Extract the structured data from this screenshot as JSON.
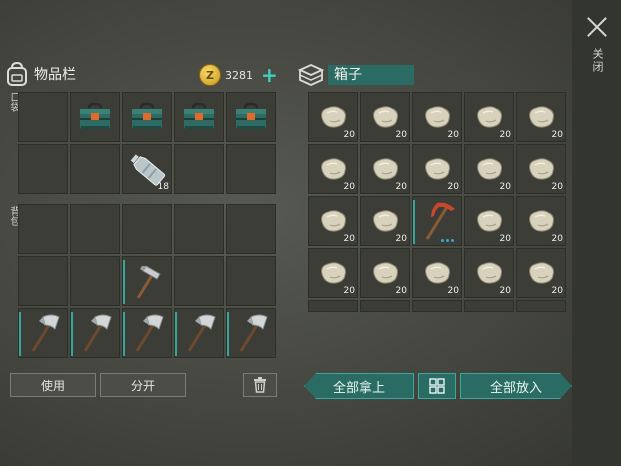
{
  "inventory": {
    "title": "物品栏",
    "coins": "3281",
    "coin_symbol": "Z",
    "plus": "+",
    "pocket_label": "口袋",
    "backpack_label": "背包",
    "pocket_slots": [
      {
        "item": "empty"
      },
      {
        "item": "toolbox"
      },
      {
        "item": "toolbox"
      },
      {
        "item": "toolbox"
      },
      {
        "item": "toolbox"
      },
      {
        "item": "empty"
      },
      {
        "item": "empty"
      },
      {
        "item": "water-bottle",
        "count": "18"
      },
      {
        "item": "empty"
      },
      {
        "item": "empty"
      }
    ],
    "backpack_slots": [
      {
        "item": "empty"
      },
      {
        "item": "empty"
      },
      {
        "item": "empty"
      },
      {
        "item": "empty"
      },
      {
        "item": "empty"
      },
      {
        "item": "empty"
      },
      {
        "item": "empty"
      },
      {
        "item": "hammer",
        "highlight": true
      },
      {
        "item": "empty"
      },
      {
        "item": "empty"
      },
      {
        "item": "hatchet",
        "highlight": true
      },
      {
        "item": "hatchet",
        "highlight": true
      },
      {
        "item": "hatchet",
        "highlight": true
      },
      {
        "item": "hatchet",
        "highlight": true
      },
      {
        "item": "hatchet",
        "highlight": true
      }
    ],
    "buttons": {
      "use": "使用",
      "split": "分开"
    },
    "trash_icon": "trash-icon"
  },
  "container": {
    "title": "箱子",
    "slots": [
      {
        "item": "stone",
        "count": "20"
      },
      {
        "item": "stone",
        "count": "20"
      },
      {
        "item": "stone",
        "count": "20"
      },
      {
        "item": "stone",
        "count": "20"
      },
      {
        "item": "stone",
        "count": "20"
      },
      {
        "item": "stone",
        "count": "20"
      },
      {
        "item": "stone",
        "count": "20"
      },
      {
        "item": "stone",
        "count": "20"
      },
      {
        "item": "stone",
        "count": "20"
      },
      {
        "item": "stone",
        "count": "20"
      },
      {
        "item": "stone",
        "count": "20"
      },
      {
        "item": "stone",
        "count": "20"
      },
      {
        "item": "pickaxe",
        "highlight": true,
        "dots": 3
      },
      {
        "item": "stone",
        "count": "20"
      },
      {
        "item": "stone",
        "count": "20"
      },
      {
        "item": "stone",
        "count": "20"
      },
      {
        "item": "stone",
        "count": "20"
      },
      {
        "item": "stone",
        "count": "20"
      },
      {
        "item": "stone",
        "count": "20"
      },
      {
        "item": "stone",
        "count": "20"
      },
      {
        "item": "empty"
      },
      {
        "item": "empty"
      },
      {
        "item": "empty"
      },
      {
        "item": "empty"
      },
      {
        "item": "empty"
      }
    ],
    "buttons": {
      "take_all": "全部拿上",
      "put_all": "全部放入"
    },
    "sort_icon": "grid-sort-icon"
  },
  "close": {
    "label": "关闭"
  },
  "colors": {
    "accent": "#2a6b64",
    "accent_border": "#3aa89a",
    "highlight": "#35a89b",
    "coin": "#e2b83a"
  }
}
